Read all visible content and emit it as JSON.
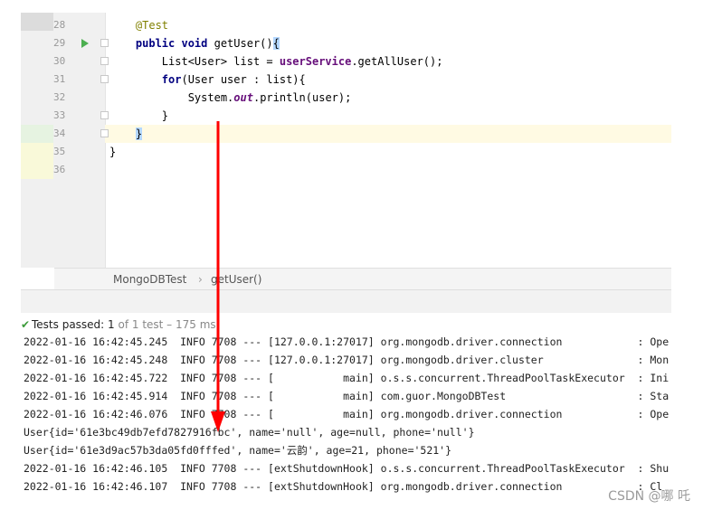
{
  "editor": {
    "line_numbers": [
      "28",
      "29",
      "30",
      "31",
      "32",
      "33",
      "34",
      "35",
      "36"
    ],
    "code_lines": [
      {
        "indent": "    ",
        "parts": [
          {
            "t": "@Test",
            "c": "ann"
          }
        ]
      },
      {
        "indent": "    ",
        "parts": [
          {
            "t": "public ",
            "c": "kw"
          },
          {
            "t": "void ",
            "c": "kw"
          },
          {
            "t": "getUser()",
            "c": ""
          },
          {
            "t": "{",
            "c": "brace"
          }
        ]
      },
      {
        "indent": "        ",
        "parts": [
          {
            "t": "List<User> list = ",
            "c": ""
          },
          {
            "t": "userService",
            "c": "fld"
          },
          {
            "t": ".getAllUser();",
            "c": ""
          }
        ]
      },
      {
        "indent": "        ",
        "parts": [
          {
            "t": "for",
            "c": "kw"
          },
          {
            "t": "(User user : list){",
            "c": ""
          }
        ]
      },
      {
        "indent": "            ",
        "parts": [
          {
            "t": "System.",
            "c": ""
          },
          {
            "t": "out",
            "c": "ital"
          },
          {
            "t": ".println(user);",
            "c": ""
          }
        ]
      },
      {
        "indent": "        ",
        "parts": [
          {
            "t": "}",
            "c": ""
          }
        ]
      },
      {
        "indent": "    ",
        "parts": [
          {
            "t": "}",
            "c": "brace"
          }
        ]
      },
      {
        "indent": "",
        "parts": [
          {
            "t": "}",
            "c": ""
          }
        ]
      },
      {
        "indent": "",
        "parts": []
      }
    ]
  },
  "breadcrumb": {
    "class_name": "MongoDBTest",
    "separator": "›",
    "method_name": "getUser()"
  },
  "status": {
    "label": "Tests passed: ",
    "count": "1",
    "rest": " of 1 test – 175 ms"
  },
  "console": {
    "lines": [
      "2022-01-16 16:42:45.245  INFO 7708 --- [127.0.0.1:27017] org.mongodb.driver.connection            : Ope",
      "2022-01-16 16:42:45.248  INFO 7708 --- [127.0.0.1:27017] org.mongodb.driver.cluster               : Mon",
      "2022-01-16 16:42:45.722  INFO 7708 --- [           main] o.s.s.concurrent.ThreadPoolTaskExecutor  : Ini",
      "2022-01-16 16:42:45.914  INFO 7708 --- [           main] com.guor.MongoDBTest                     : Sta",
      "2022-01-16 16:42:46.076  INFO 7708 --- [           main] org.mongodb.driver.connection            : Ope",
      "User{id='61e3bc49db7efd7827916fbc', name='null', age=null, phone='null'}",
      "User{id='61e3d9ac57b3da05fd0fffed', name='云韵', age=21, phone='521'}",
      "2022-01-16 16:42:46.105  INFO 7708 --- [extShutdownHook] o.s.s.concurrent.ThreadPoolTaskExecutor  : Shu",
      "2022-01-16 16:42:46.107  INFO 7708 --- [extShutdownHook] org.mongodb.driver.connection            : Cl"
    ]
  },
  "watermark": "CSDN @哪 吒",
  "colors": {
    "arrow": "#ff0000",
    "keyword": "#000080",
    "annotation": "#808000",
    "field": "#660e7a",
    "pass_check": "#3d9b3a"
  }
}
